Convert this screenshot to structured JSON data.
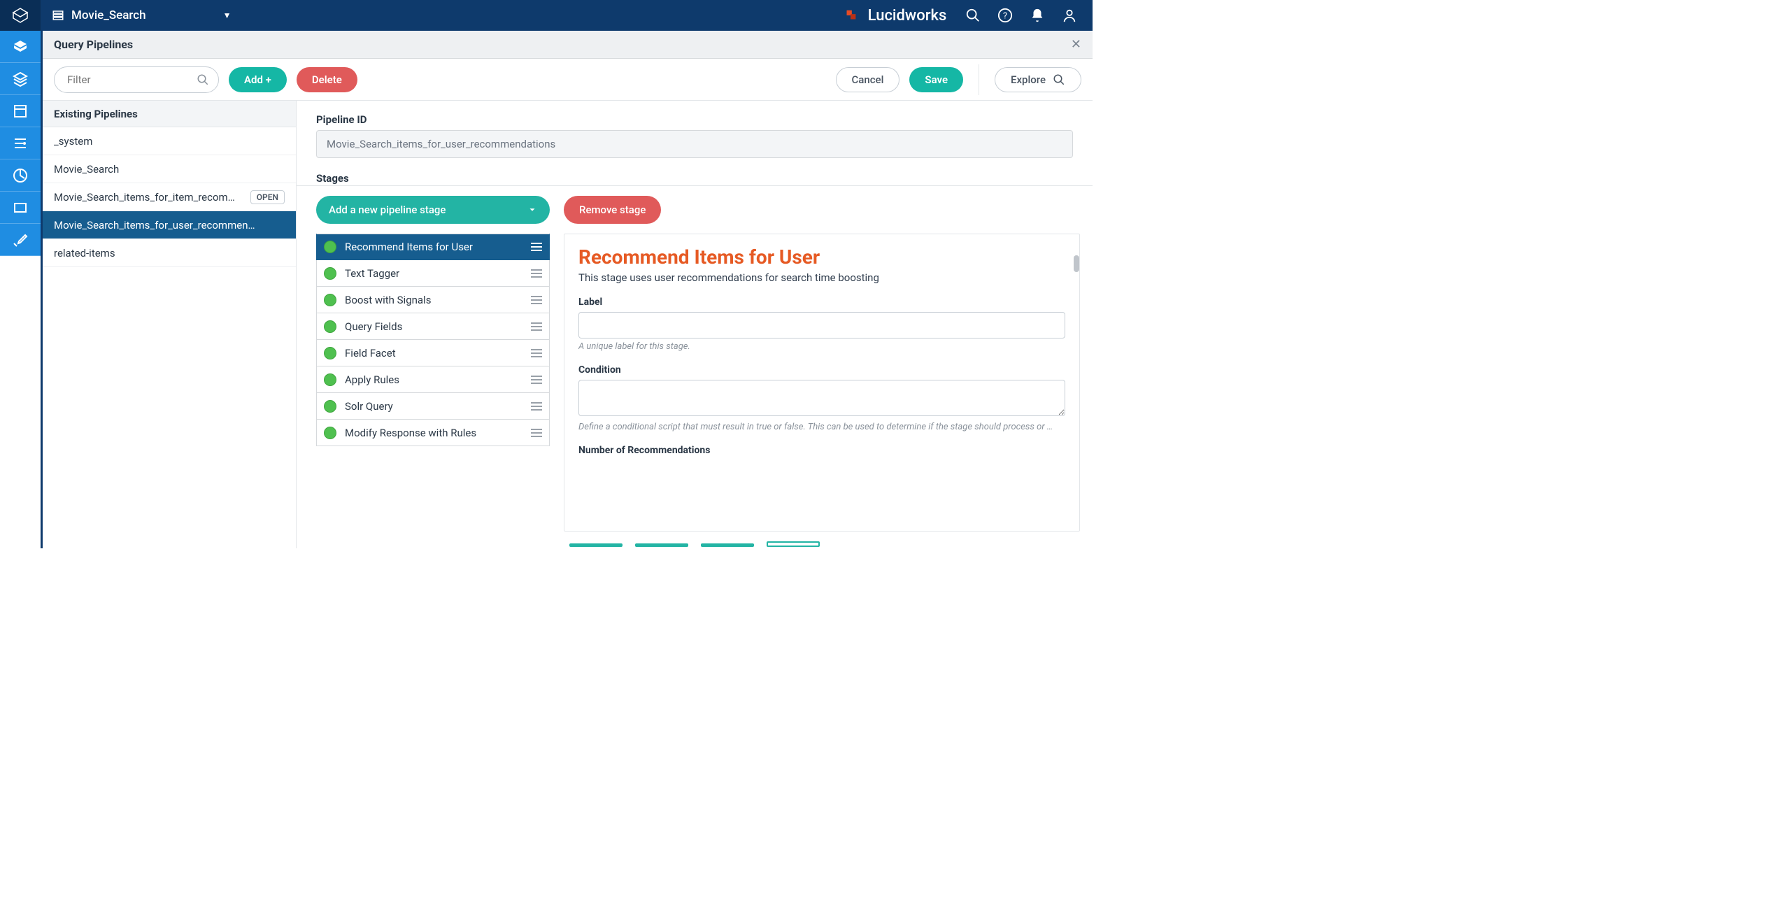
{
  "header": {
    "app_name": "Movie_Search",
    "brand": "Lucidworks"
  },
  "page": {
    "title": "Query Pipelines"
  },
  "toolbar": {
    "filter_placeholder": "Filter",
    "add_label": "Add +",
    "delete_label": "Delete",
    "cancel_label": "Cancel",
    "save_label": "Save",
    "explore_label": "Explore"
  },
  "sidebar": {
    "section_title": "Existing Pipelines",
    "open_label": "OPEN",
    "items": [
      {
        "label": "_system"
      },
      {
        "label": "Movie_Search"
      },
      {
        "label": "Movie_Search_items_for_item_recommendations",
        "open": true
      },
      {
        "label": "Movie_Search_items_for_user_recommendations",
        "active": true
      },
      {
        "label": "related-items"
      }
    ]
  },
  "pipeline": {
    "id_label": "Pipeline ID",
    "id_value": "Movie_Search_items_for_user_recommendations",
    "stages_label": "Stages",
    "add_stage_label": "Add a new pipeline stage",
    "remove_stage_label": "Remove stage",
    "stages": [
      {
        "name": "Recommend Items for User",
        "active": true
      },
      {
        "name": "Text Tagger"
      },
      {
        "name": "Boost with Signals"
      },
      {
        "name": "Query Fields"
      },
      {
        "name": "Field Facet"
      },
      {
        "name": "Apply Rules"
      },
      {
        "name": "Solr Query"
      },
      {
        "name": "Modify Response with Rules"
      }
    ]
  },
  "stage_detail": {
    "title": "Recommend Items for User",
    "subtitle": "This stage uses user recommendations for search time boosting",
    "label_field": "Label",
    "label_help": "A unique label for this stage.",
    "condition_field": "Condition",
    "condition_help": "Define a conditional script that must result in true or false. This can be used to determine if the stage should process or …",
    "num_rec_field": "Number of Recommendations"
  }
}
